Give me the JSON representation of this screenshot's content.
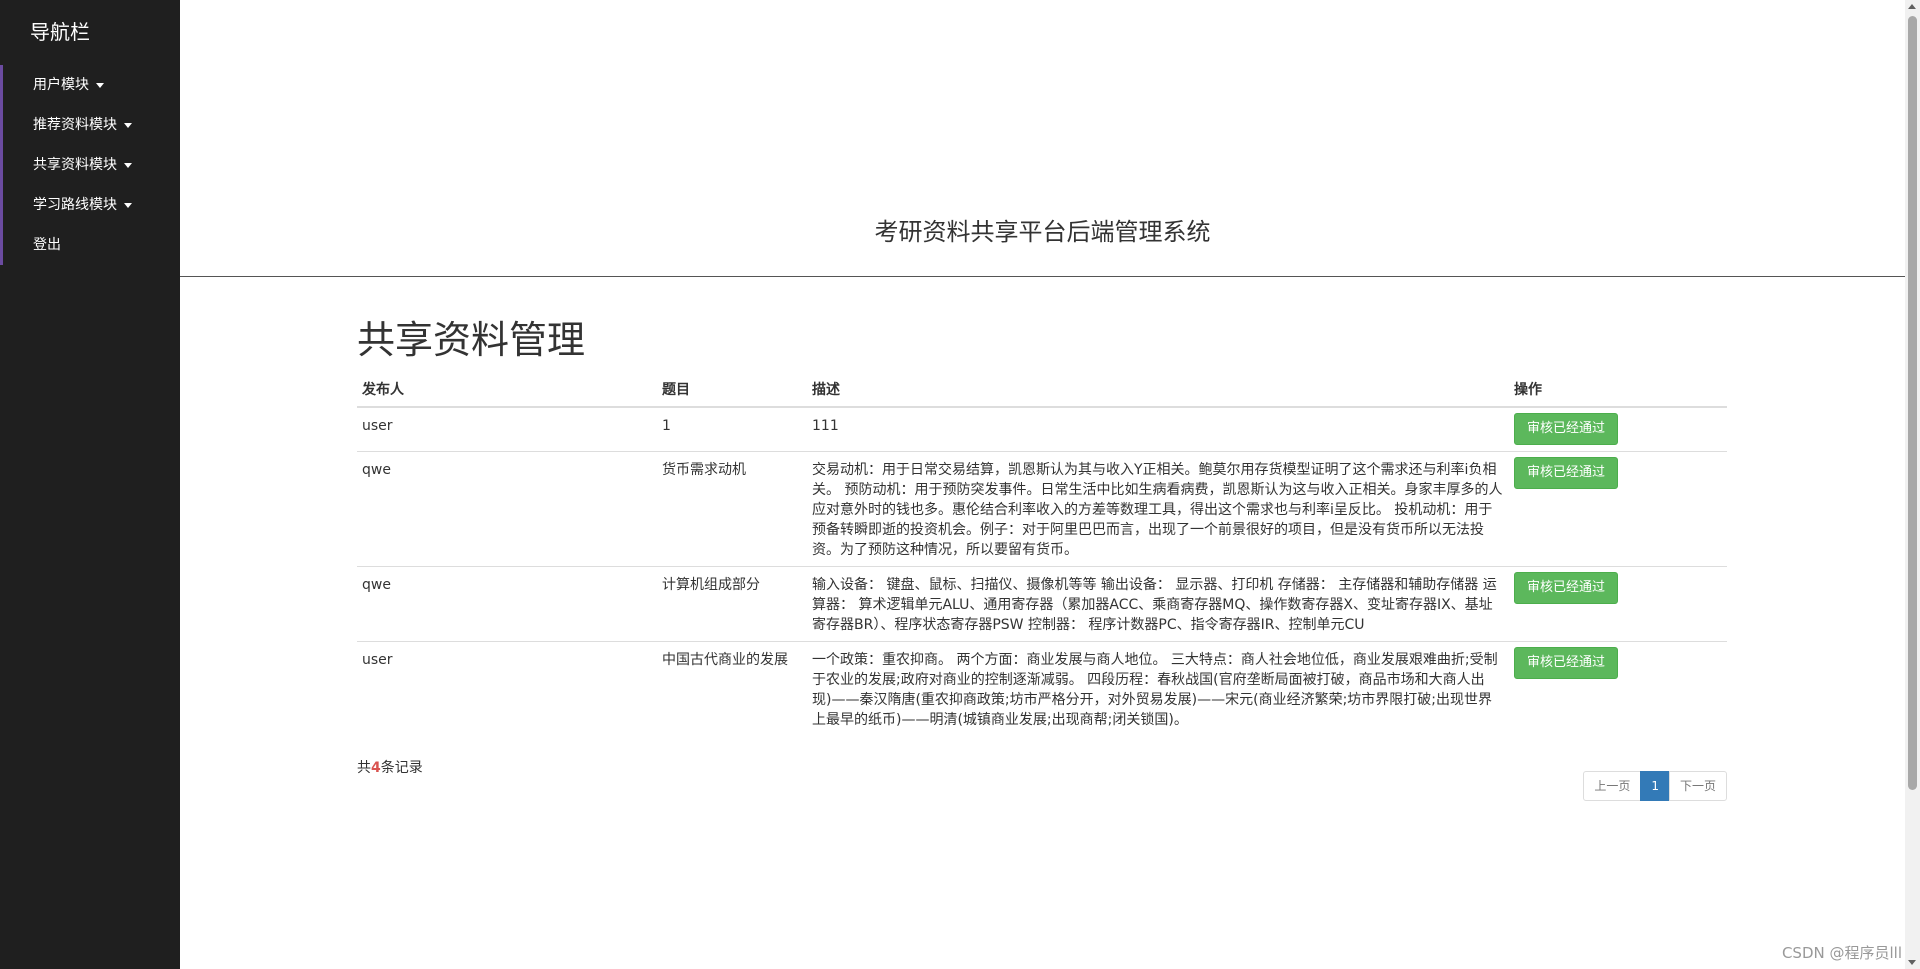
{
  "sidebar": {
    "title": "导航栏",
    "items": [
      {
        "label": "用户模块",
        "has_caret": true
      },
      {
        "label": "推荐资料模块",
        "has_caret": true
      },
      {
        "label": "共享资料模块",
        "has_caret": true
      },
      {
        "label": "学习路线模块",
        "has_caret": true
      },
      {
        "label": "登出",
        "has_caret": false
      }
    ]
  },
  "header": {
    "system_title": "考研资料共享平台后端管理系统"
  },
  "main": {
    "page_title": "共享资料管理",
    "table": {
      "columns": [
        "发布人",
        "题目",
        "描述",
        "操作"
      ],
      "rows": [
        {
          "publisher": "user",
          "subject": "1",
          "description": "111",
          "action": "审核已经通过"
        },
        {
          "publisher": "qwe",
          "subject": "货币需求动机",
          "description": "交易动机：用于日常交易结算，凯恩斯认为其与收入Y正相关。鲍莫尔用存货模型证明了这个需求还与利率i负相关。 预防动机：用于预防突发事件。日常生活中比如生病看病费，凯恩斯认为这与收入正相关。身家丰厚多的人应对意外时的钱也多。惠伦结合利率收入的方差等数理工具，得出这个需求也与利率i呈反比。 投机动机：用于预备转瞬即逝的投资机会。例子：对于阿里巴巴而言，出现了一个前景很好的项目，但是没有货币所以无法投资。为了预防这种情况，所以要留有货币。",
          "action": "审核已经通过"
        },
        {
          "publisher": "qwe",
          "subject": "计算机组成部分",
          "description": "输入设备： 键盘、鼠标、扫描仪、摄像机等等 输出设备： 显示器、打印机 存储器： 主存储器和辅助存储器 运算器： 算术逻辑单元ALU、通用寄存器（累加器ACC、乘商寄存器MQ、操作数寄存器X、变址寄存器IX、基址寄存器BR）、程序状态寄存器PSW 控制器： 程序计数器PC、指令寄存器IR、控制单元CU",
          "action": "审核已经通过"
        },
        {
          "publisher": "user",
          "subject": "中国古代商业的发展",
          "description": "一个政策：重农抑商。 两个方面：商业发展与商人地位。 三大特点：商人社会地位低，商业发展艰难曲折;受制于农业的发展;政府对商业的控制逐渐减弱。 四段历程：春秋战国(官府垄断局面被打破，商品市场和大商人出现)——秦汉隋唐(重农抑商政策;坊市严格分开，对外贸易发展)——宋元(商业经济繁荣;坊市界限打破;出现世界上最早的纸币)——明清(城镇商业发展;出现商帮;闭关锁国)。",
          "action": "审核已经通过"
        }
      ]
    },
    "total": {
      "prefix": "共",
      "count": "4",
      "suffix": "条记录"
    },
    "pagination": {
      "prev": "上一页",
      "current": "1",
      "next": "下一页"
    }
  },
  "watermark": "CSDN @程序员lll",
  "colors": {
    "sidebar_bg": "#1f1f1f",
    "sidebar_accent": "#6b4ba0",
    "approve_button": "#5cb85c",
    "pagination_active": "#337ab7",
    "count_highlight": "#d9534f"
  }
}
